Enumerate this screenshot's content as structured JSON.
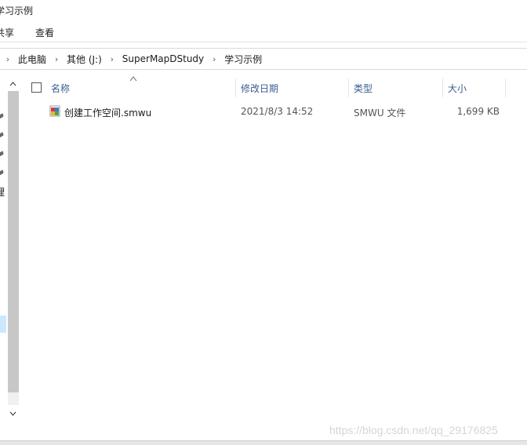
{
  "window": {
    "title": "学习示例"
  },
  "ribbon": {
    "tabs": [
      "共享",
      "查看"
    ]
  },
  "address_bar": {
    "breadcrumbs": [
      "此电脑",
      "其他 (J:)",
      "SuperMapDStudy",
      "学习示例"
    ]
  },
  "navigation": {
    "partial_label": "理"
  },
  "file_list": {
    "columns": {
      "name": "名称",
      "modified": "修改日期",
      "type": "类型",
      "size": "大小"
    },
    "sort_column": "name",
    "rows": [
      {
        "name": "创建工作空间.smwu",
        "modified": "2021/8/3 14:52",
        "type": "SMWU 文件",
        "size": "1,699 KB",
        "icon": "smwu-file-icon"
      }
    ]
  },
  "watermark": "https://blog.csdn.net/qq_29176825"
}
